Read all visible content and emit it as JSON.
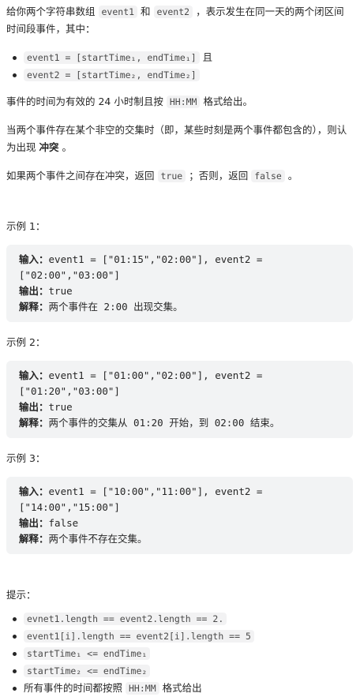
{
  "intro": {
    "p1_a": "给你两个字符串数组",
    "p1_code1": "event1",
    "p1_b": "和",
    "p1_code2": "event2",
    "p1_c": "，表示发生在同一天的两个闭区间时间段事件，其中：",
    "bullet1_code": "event1 = [startTime₁, endTime₁]",
    "bullet1_after": "且",
    "bullet2_code": "event2 = [startTime₂, endTime₂]",
    "p2_a": "事件的时间为有效的 24 小时制且按",
    "p2_code": "HH:MM",
    "p2_b": "格式给出。",
    "p3_a": "当两个事件存在某个非空的交集时（即，某些时刻是两个事件都包含的），则认为出现",
    "p3_bold": "冲突",
    "p3_b": "。",
    "p4_a": "如果两个事件之间存在冲突，返回",
    "p4_code1": "true",
    "p4_b": "；否则，返回",
    "p4_code2": "false",
    "p4_c": "。"
  },
  "examples": [
    {
      "title": "示例 1：",
      "input_label": "输入：",
      "input_text": "event1 = [\"01:15\",\"02:00\"], event2 = [\"02:00\",\"03:00\"]",
      "output_label": "输出：",
      "output_text": "true",
      "explain_label": "解释：",
      "explain_text": "两个事件在 2:00 出现交集。"
    },
    {
      "title": "示例 2：",
      "input_label": "输入：",
      "input_text": "event1 = [\"01:00\",\"02:00\"], event2 = [\"01:20\",\"03:00\"]",
      "output_label": "输出：",
      "output_text": "true",
      "explain_label": "解释：",
      "explain_text": "两个事件的交集从 01:20 开始，到 02:00 结束。"
    },
    {
      "title": "示例 3：",
      "input_label": "输入：",
      "input_text": "event1 = [\"10:00\",\"11:00\"], event2 = [\"14:00\",\"15:00\"]",
      "output_label": "输出：",
      "output_text": "false",
      "explain_label": "解释：",
      "explain_text": "两个事件不存在交集。"
    }
  ],
  "hints": {
    "title": "提示：",
    "items": [
      "evnet1.length == event2.length == 2.",
      "event1[i].length == event2[i].length == 5",
      "startTime₁ <= endTime₁",
      "startTime₂ <= endTime₂"
    ],
    "last_a": "所有事件的时间都按照",
    "last_code": "HH:MM",
    "last_b": "格式给出"
  }
}
